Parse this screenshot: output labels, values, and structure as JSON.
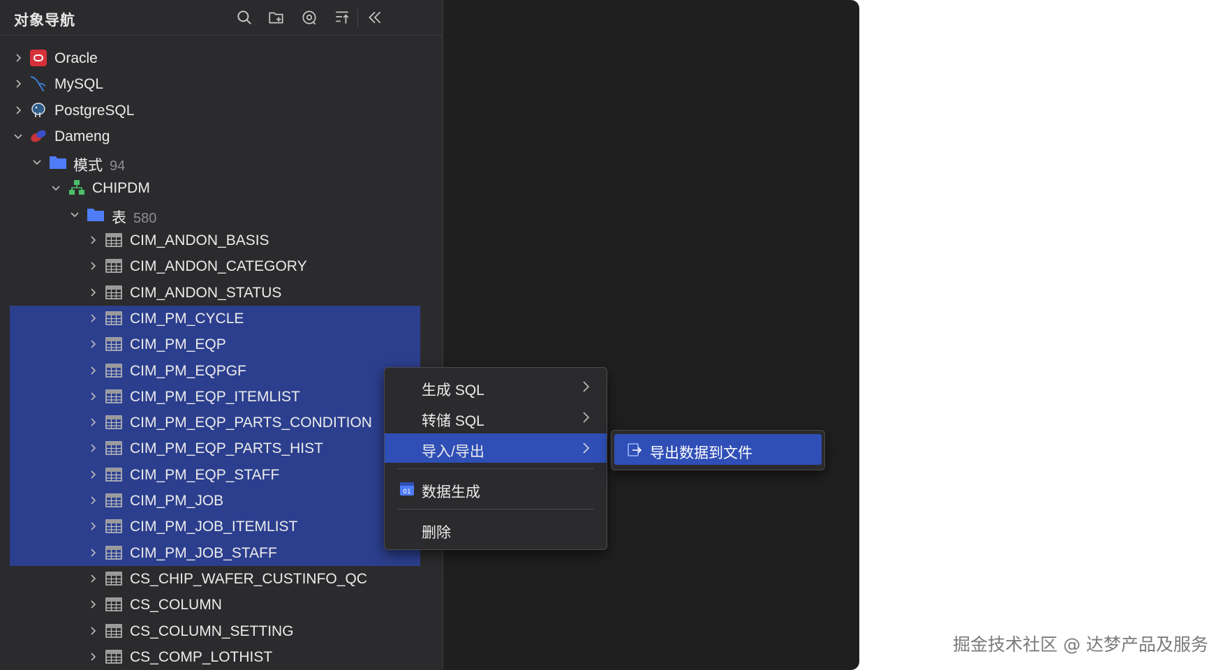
{
  "panel": {
    "title": "对象导航"
  },
  "toolbar": {
    "icons": [
      "search-icon",
      "new-folder-icon",
      "filter-settings-icon",
      "sort-icon",
      "collapse-panel-icon"
    ]
  },
  "tree": {
    "connections": [
      {
        "label": "Oracle",
        "icon": "oracle-icon",
        "expanded": false
      },
      {
        "label": "MySQL",
        "icon": "mysql-dolphin-icon",
        "expanded": false
      },
      {
        "label": "PostgreSQL",
        "icon": "postgresql-elephant-icon",
        "expanded": false
      },
      {
        "label": "Dameng",
        "icon": "dameng-icon",
        "expanded": true
      }
    ],
    "schemas": {
      "label": "模式",
      "count": "94"
    },
    "schema": {
      "label": "CHIPDM"
    },
    "tables_folder": {
      "label": "表",
      "count": "580"
    },
    "tables": [
      {
        "label": "CIM_ANDON_BASIS",
        "selected": false
      },
      {
        "label": "CIM_ANDON_CATEGORY",
        "selected": false
      },
      {
        "label": "CIM_ANDON_STATUS",
        "selected": false
      },
      {
        "label": "CIM_PM_CYCLE",
        "selected": true
      },
      {
        "label": "CIM_PM_EQP",
        "selected": true
      },
      {
        "label": "CIM_PM_EQPGF",
        "selected": true
      },
      {
        "label": "CIM_PM_EQP_ITEMLIST",
        "selected": true
      },
      {
        "label": "CIM_PM_EQP_PARTS_CONDITION",
        "selected": true
      },
      {
        "label": "CIM_PM_EQP_PARTS_HIST",
        "selected": true
      },
      {
        "label": "CIM_PM_EQP_STAFF",
        "selected": true
      },
      {
        "label": "CIM_PM_JOB",
        "selected": true
      },
      {
        "label": "CIM_PM_JOB_ITEMLIST",
        "selected": true
      },
      {
        "label": "CIM_PM_JOB_STAFF",
        "selected": true
      },
      {
        "label": "CS_CHIP_WAFER_CUSTINFO_QC",
        "selected": false
      },
      {
        "label": "CS_COLUMN",
        "selected": false
      },
      {
        "label": "CS_COLUMN_SETTING",
        "selected": false
      },
      {
        "label": "CS_COMP_LOTHIST",
        "selected": false
      }
    ]
  },
  "context_menu": {
    "generate_sql": "生成 SQL",
    "dump_sql": "转储 SQL",
    "import_export": "导入/导出",
    "data_generation": "数据生成",
    "delete": "删除"
  },
  "submenu": {
    "export_to_file": "导出数据到文件"
  },
  "watermark": "掘金技术社区 @ 达梦产品及服务",
  "colors": {
    "selection": "#2c3f8e",
    "menu_highlight": "#2f4fb7",
    "folder": "#4f7cf7",
    "oracle": "#d6303a"
  }
}
